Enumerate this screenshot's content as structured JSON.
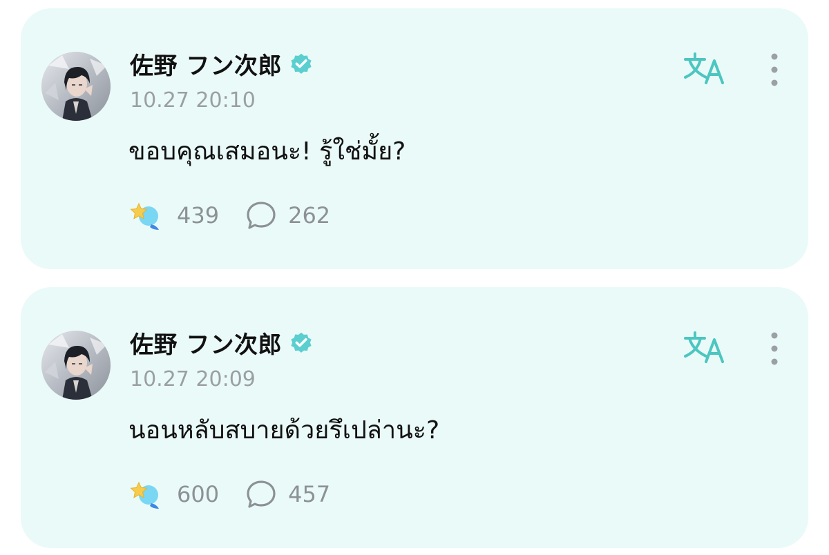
{
  "theme": {
    "card_background": "#eafaf8",
    "accent": "#4cc6c0",
    "verified_color": "#5bcfd0",
    "text_primary": "#111111",
    "text_secondary": "#9a9fa3"
  },
  "posts": [
    {
      "author": "佐野 フン次郎",
      "verified": true,
      "timestamp": "10.27 20:10",
      "text": "ขอบคุณเสมอนะ! รู้ใช่มั้ย?",
      "reactions": "439",
      "comments": "262",
      "icons": {
        "avatar": "avatar-photo",
        "verified": "verified-badge-icon",
        "translate": "translate-icon",
        "more": "more-vertical-icon",
        "reaction": "star-reaction-icon",
        "comment": "comment-bubble-icon"
      }
    },
    {
      "author": "佐野 フン次郎",
      "verified": true,
      "timestamp": "10.27 20:09",
      "text": "นอนหลับสบายด้วยรึเปล่านะ?",
      "reactions": "600",
      "comments": "457",
      "icons": {
        "avatar": "avatar-photo",
        "verified": "verified-badge-icon",
        "translate": "translate-icon",
        "more": "more-vertical-icon",
        "reaction": "star-reaction-icon",
        "comment": "comment-bubble-icon"
      }
    }
  ]
}
